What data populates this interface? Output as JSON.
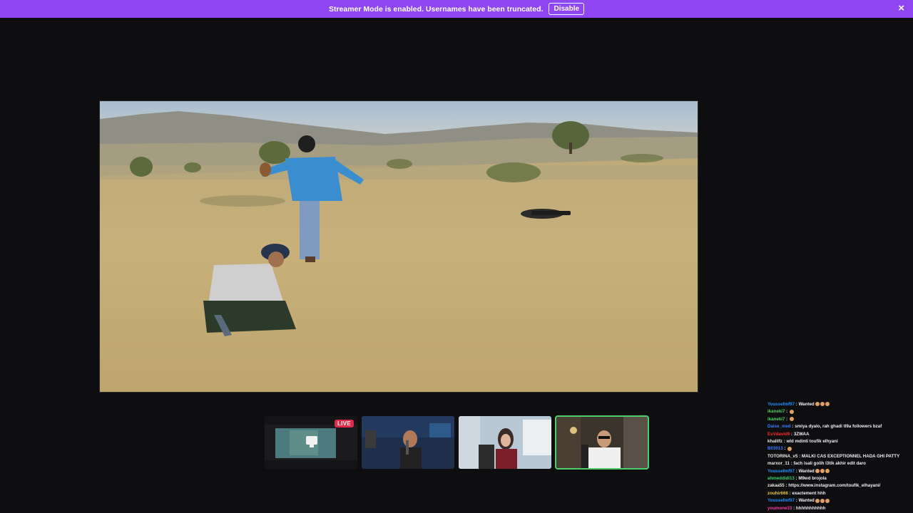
{
  "banner": {
    "message": "Streamer Mode is enabled. Usernames have been truncated.",
    "disable_label": "Disable",
    "close_icon": "×"
  },
  "colors": {
    "banner_bg": "#8f45f0",
    "page_bg": "#0e0e10",
    "live_badge": "#e02b48",
    "active_outline": "#4ccf6b"
  },
  "thumbnails": [
    {
      "live_label": "LIVE"
    }
  ],
  "chat": {
    "messages": [
      {
        "user": "Youssefmf97",
        "color": "#1e90ff",
        "text": "Wanted",
        "emotes": 3
      },
      {
        "user": "ikaneki7",
        "color": "#4fd35f",
        "text": "",
        "emotes": 1
      },
      {
        "user": "ikaneki7",
        "color": "#4fd35f",
        "text": "",
        "emotes": 1
      },
      {
        "user": "Daise_med",
        "color": "#3d7bff",
        "text": "smiya dyalo, rah ghadi tl9a followers bzaf",
        "emotes": 0
      },
      {
        "user": "EsVdavid9",
        "color": "#ff2b2b",
        "text": "3ZWAA",
        "emotes": 0
      },
      {
        "user": "khalilfz",
        "color": "#e8e8e8",
        "text": "wld mdinti toufik elhyani",
        "emotes": 0
      },
      {
        "user": "B03013",
        "color": "#3d7bff",
        "text": "",
        "emotes": 1
      },
      {
        "user": "TOTORINA_v5",
        "color": "#e8e8e8",
        "text": "MALKI CAS EXCEPTIONNEL HADA GHI PATTY",
        "emotes": 0
      },
      {
        "user": "marxor_11",
        "color": "#e8e8e8",
        "text": "fach isali golih l3tik akhir edit daro",
        "emotes": 0
      },
      {
        "user": "Youssefmf97",
        "color": "#1e90ff",
        "text": "Wanted",
        "emotes": 3
      },
      {
        "user": "ahmeddidi13",
        "color": "#3ad46a",
        "text": "M9wd brojola",
        "emotes": 0
      },
      {
        "user": "zakaa55",
        "color": "#e8e8e8",
        "text": "https://www.instagram.com/toufik_elhayani/",
        "emotes": 0
      },
      {
        "user": "zouhir666",
        "color": "#e8c84a",
        "text": "exactement hhh",
        "emotes": 0
      },
      {
        "user": "Youssefmf97",
        "color": "#1e90ff",
        "text": "Wanted",
        "emotes": 3
      },
      {
        "user": "youmone33",
        "color": "#ff3da8",
        "text": "hhhhhhhhhhh",
        "emotes": 0
      }
    ]
  }
}
